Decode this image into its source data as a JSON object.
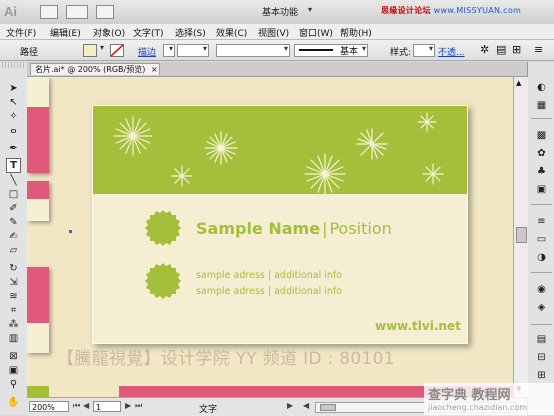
{
  "app": {
    "logo": "Ai",
    "workspace": "基本功能",
    "watermark_top_red": "思缘设计论坛",
    "watermark_top_blue": "www.MISSYUAN.com",
    "window_controls": [
      "-",
      "□",
      "×"
    ]
  },
  "menu": [
    "文件(F)",
    "编辑(E)",
    "对象(O)",
    "文字(T)",
    "选择(S)",
    "效果(C)",
    "视图(V)",
    "窗口(W)",
    "帮助(H)"
  ],
  "control_panel": {
    "label": "路径",
    "stroke_label": "描边",
    "stroke_profile": "基本",
    "style_label": "样式:",
    "opacity_label": "不透...",
    "fill_color": "#f4eec8",
    "stroke_color": "#ffffff"
  },
  "document": {
    "tab_title": "名片.ai* @ 200% (RGB/预览)",
    "close": "×"
  },
  "card": {
    "band_color": "#a4c03b",
    "bg_color": "#f5eed2",
    "name": "Sample Name",
    "divider": "|",
    "position": "Position",
    "address_1": "sample adress | additional info",
    "address_2": "sample adress | additional info",
    "website": "www.tlvi.net"
  },
  "overlay_watermark": "【騰龍視覺】设计学院  YY 频道 ID : 80101",
  "status": {
    "zoom": "200%",
    "page": "1",
    "mode": "文字"
  },
  "site_watermark": {
    "big": "查字典 教程网",
    "small": "jiaocheng.chazidian.com"
  },
  "tools": [
    "selection-tool",
    "direct-selection-tool",
    "magic-wand-tool",
    "lasso-tool",
    "pen-tool",
    "type-tool",
    "line-tool",
    "rectangle-tool",
    "paintbrush-tool",
    "pencil-tool",
    "blob-brush-tool",
    "eraser-tool",
    "rotate-tool",
    "scale-tool",
    "warp-tool",
    "free-transform-tool",
    "symbol-sprayer-tool",
    "graph-tool",
    "mesh-tool",
    "gradient-tool",
    "eyedropper-tool",
    "blend-tool",
    "live-paint-tool",
    "artboard-tool",
    "slice-tool",
    "hand-tool",
    "zoom-tool"
  ],
  "dock": [
    "color-panel",
    "color-guide-panel",
    "swatches-panel",
    "brushes-panel",
    "symbols-panel",
    "graphic-styles-panel",
    "stroke-panel",
    "gradient-panel",
    "transparency-panel",
    "appearance-panel",
    "layers-panel",
    "artboards-panel",
    "align-panel"
  ]
}
